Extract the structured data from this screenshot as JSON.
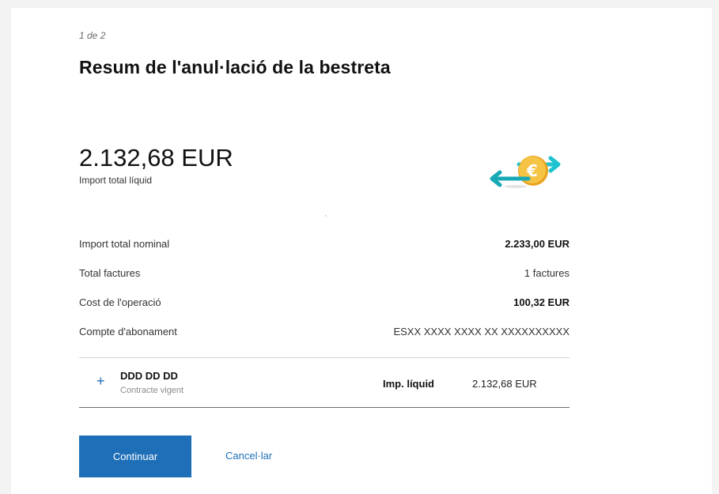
{
  "header": {
    "step": "1 de 2",
    "title": "Resum de l'anul·lació de la bestreta"
  },
  "summary": {
    "total_amount": "2.132,68 EUR",
    "total_amount_label": "Import total líquid",
    "illustration_icon": "euro-exchange-icon"
  },
  "details": [
    {
      "label": "Import total nominal",
      "value": "2.233,00 EUR",
      "bold": true
    },
    {
      "label": "Total factures",
      "value": "1 factures",
      "bold": false
    },
    {
      "label": "Cost de l'operació",
      "value": "100,32 EUR",
      "bold": true
    },
    {
      "label": "Compte d'abonament",
      "value": "ESXX XXXX XXXX XX XXXXXXXXXX",
      "bold": false
    }
  ],
  "contract": {
    "expand_symbol": "+",
    "name": "DDD DD DD",
    "status": "Contracte vigent",
    "amount_label": "Imp. líquid",
    "amount_value": "2.132,68 EUR"
  },
  "actions": {
    "continue_label": "Continuar",
    "cancel_label": "Cancel·lar"
  },
  "colors": {
    "accent": "#1e6fb8",
    "coin": "#f2b632",
    "arrow_right": "#1fc3cf",
    "arrow_left": "#17a9b5"
  }
}
